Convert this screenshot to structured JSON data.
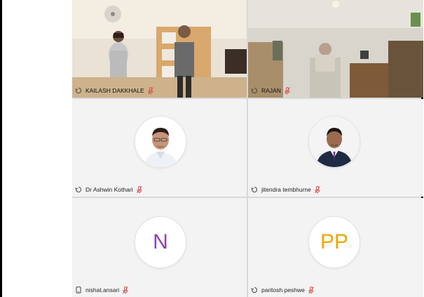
{
  "participants": [
    {
      "name": "KAILASH DAKKHALE",
      "type": "video",
      "muted": true
    },
    {
      "name": "RAJAN",
      "type": "video",
      "muted": true
    },
    {
      "name": "Dr Ashwin Kothari",
      "type": "photo",
      "muted": true
    },
    {
      "name": "jitendra tembhurne",
      "type": "photo",
      "muted": true
    },
    {
      "name": "nishat.ansari",
      "type": "initials",
      "initials": "N",
      "initials_color": "#8e44ad",
      "muted": true
    },
    {
      "name": "paritosh peshwe",
      "type": "initials",
      "initials": "PP",
      "initials_color": "#f0a500",
      "muted": true
    }
  ],
  "colors": {
    "muted_mic": "#d9534f",
    "tile_bg": "#f3f3f3",
    "divider": "#d8d8d8"
  }
}
